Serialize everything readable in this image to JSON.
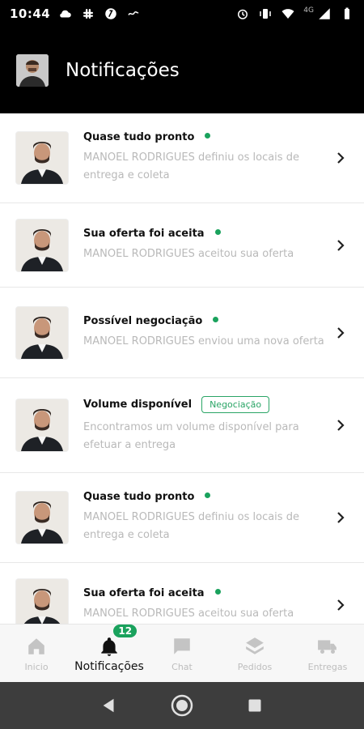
{
  "status_bar": {
    "time": "10:44",
    "network": "4G"
  },
  "header": {
    "title": "Notificações"
  },
  "notifications": [
    {
      "title": "Quase tudo pronto",
      "description": "MANOEL RODRIGUES definiu os locais de entrega e coleta",
      "badge": ""
    },
    {
      "title": "Sua oferta foi aceita",
      "description": "MANOEL RODRIGUES aceitou sua oferta",
      "badge": ""
    },
    {
      "title": "Possível negociação",
      "description": "MANOEL RODRIGUES enviou uma nova oferta",
      "badge": ""
    },
    {
      "title": "Volume disponível",
      "description": "Encontramos um volume disponível para efetuar a entrega",
      "badge": "Negociação"
    },
    {
      "title": "Quase tudo pronto",
      "description": "MANOEL RODRIGUES definiu os locais de entrega e coleta",
      "badge": ""
    },
    {
      "title": "Sua oferta foi aceita",
      "description": "MANOEL RODRIGUES aceitou sua oferta",
      "badge": ""
    }
  ],
  "bottom_nav": {
    "items": [
      {
        "label": "Inicio",
        "icon": "home-icon"
      },
      {
        "label": "Notificações",
        "icon": "bell-icon",
        "badge": "12",
        "active": true
      },
      {
        "label": "Chat",
        "icon": "chat-icon"
      },
      {
        "label": "Pedidos",
        "icon": "layers-icon"
      },
      {
        "label": "Entregas",
        "icon": "truck-icon"
      }
    ]
  },
  "colors": {
    "accent": "#1aa25d",
    "appbar": "#000000",
    "muted_text": "#b9b9b9"
  }
}
